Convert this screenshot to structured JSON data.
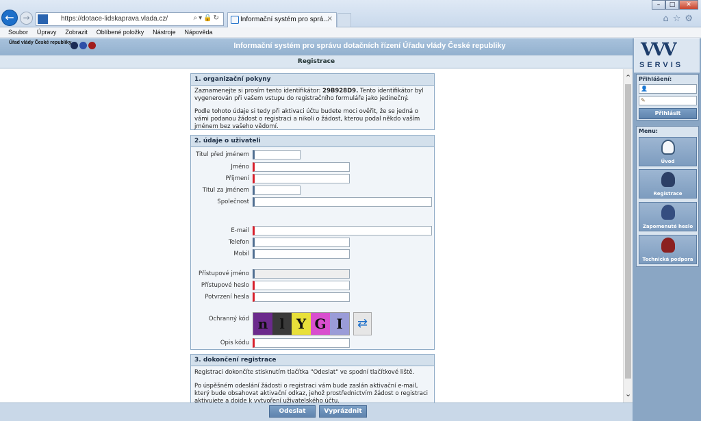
{
  "browser": {
    "url": "https://dotace-lidskaprava.vlada.cz/",
    "tab_title": "Informační systém pro sprá...",
    "tab_close": "×",
    "menu": [
      "Soubor",
      "Úpravy",
      "Zobrazit",
      "Oblíbené položky",
      "Nástroje",
      "Nápověda"
    ]
  },
  "header": {
    "org": "Úřad vlády České republiky",
    "app_title": "Informační systém pro správu dotačních řízení Úřadu vlády České republiky",
    "subtitle": "Registrace"
  },
  "section1": {
    "title": "1. organizační pokyny",
    "text1_a": "Zaznamenejte si prosím tento identifikátor:",
    "identifier": "29B928D9.",
    "text1_b": "Tento identifikátor byl vygenerován při vašem vstupu do registračního formuláře jako jedinečný.",
    "text2": "Podle tohoto údaje si tedy při aktivaci účtu budete moci ověřit, že se jedná o vámi podanou žádost o registraci a nikoli o žádost, kterou podal někdo vaším jménem bez vašeho vědomí."
  },
  "section2": {
    "title": "2. údaje o uživateli",
    "fields": {
      "title_before": "Titul před jménem",
      "first_name": "Jméno",
      "last_name": "Příjmení",
      "title_after": "Titul za jménem",
      "company": "Společnost",
      "email": "E-mail",
      "phone": "Telefon",
      "mobile": "Mobil",
      "username": "Přístupové jméno",
      "password": "Přístupové heslo",
      "password_confirm": "Potvrzení hesla",
      "captcha": "Ochranný kód",
      "captcha_copy": "Opis kódu"
    },
    "captcha_chars": [
      "n",
      "l",
      "Y",
      "G",
      "I"
    ],
    "captcha_colors": [
      "#6b2a8c",
      "#3a3a3a",
      "#e8e03a",
      "#d94fcf",
      "#9a9cd8"
    ]
  },
  "section3": {
    "title": "3. dokončení registrace",
    "text1": "Registraci dokončíte stisknutím tlačítka \"Odeslat\" ve spodní tlačítkové liště.",
    "text2": "Po úspěšném odeslání žádosti o registraci vám bude zaslán aktivační e-mail, který bude obsahovat aktivační odkaz, jehož prostřednictvím žádost o registraci aktivujete a dojde k vytvoření uživatelského účtu."
  },
  "buttons": {
    "send": "Odeslat",
    "clear": "Vyprázdnit"
  },
  "sidebar": {
    "logo_word": "SERVIS",
    "login_title": "Přihlášení:",
    "login_button": "Přihlásit",
    "menu_title": "Menu:",
    "items": [
      {
        "label": "Úvod",
        "icon": "info-icon"
      },
      {
        "label": "Registrace",
        "icon": "person-icon"
      },
      {
        "label": "Zapomenuté heslo",
        "icon": "person-key-icon"
      },
      {
        "label": "Technická podpora",
        "icon": "support-person-icon"
      }
    ]
  },
  "colors": {
    "required": "#d81e2a",
    "optional": "#4f6e91",
    "header": "#93b1cf"
  }
}
